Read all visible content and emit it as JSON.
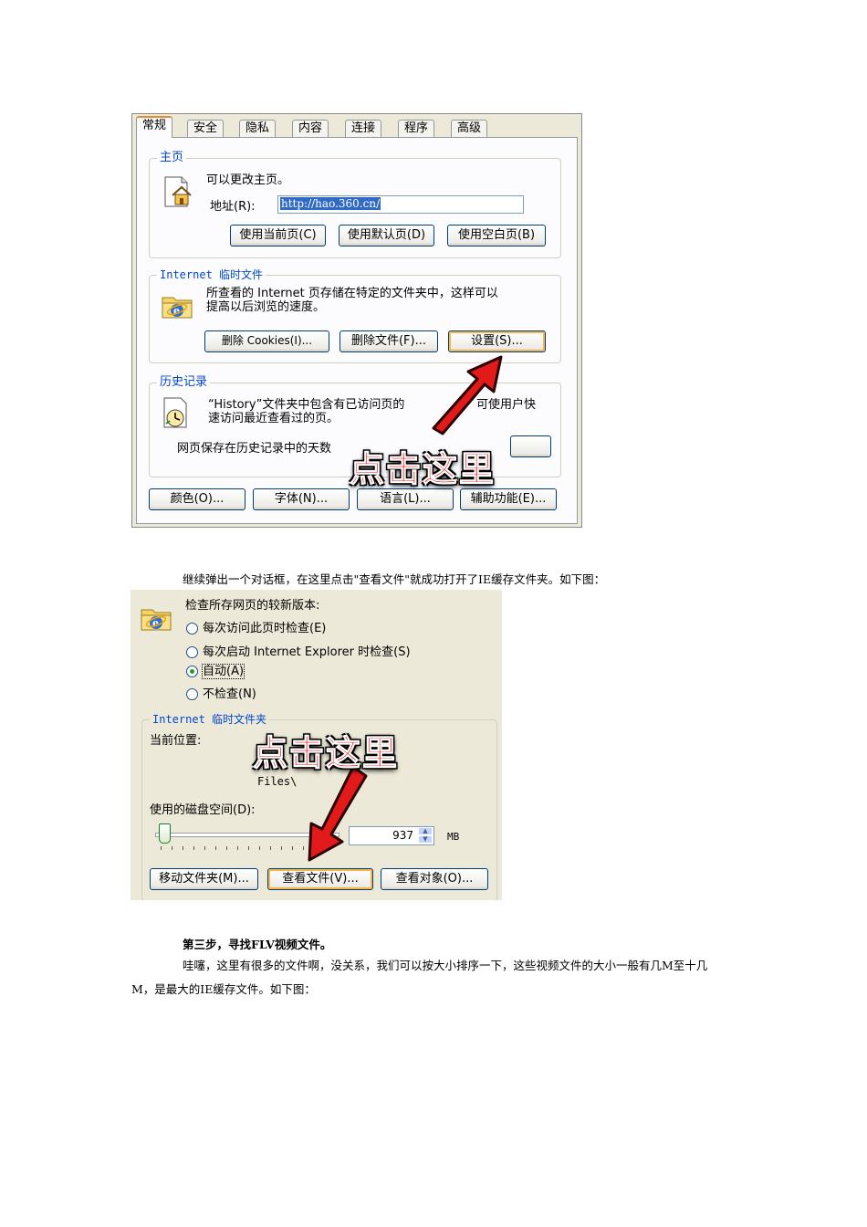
{
  "dialog1": {
    "tabs": [
      "常规",
      "安全",
      "隐私",
      "内容",
      "连接",
      "程序",
      "高级"
    ],
    "homepage": {
      "title": "主页",
      "desc": "可以更改主页。",
      "address_label": "地址(R):",
      "address_value": "http://hao.360.cn/",
      "buttons": [
        "使用当前页(C)",
        "使用默认页(D)",
        "使用空白页(B)"
      ]
    },
    "temp_files": {
      "title": "Internet 临时文件",
      "desc_line1": "所查看的 Internet 页存储在特定的文件夹中，这样可以",
      "desc_line2": "提高以后浏览的速度。",
      "buttons": [
        "删除 Cookies(I)...",
        "删除文件(F)...",
        "设置(S)..."
      ]
    },
    "history": {
      "title": "历史记录",
      "desc_line1": "“History”文件夹中包含有已访问页的",
      "desc_line1b": "可使用户快",
      "desc_line2": "速访问最近查看过的页。",
      "days_label": "网页保存在历史记录中的天数"
    },
    "bottom_buttons": [
      "颜色(O)...",
      "字体(N)...",
      "语言(L)...",
      "辅助功能(E)..."
    ],
    "callout": "点击这里"
  },
  "caption1": "继续弹出一个对话框，在这里点击\"查看文件\"就成功打开了IE缓存文件夹。如下图：",
  "dialog2": {
    "check_label": "检查所存网页的较新版本:",
    "options": [
      {
        "label": "每次访问此页时检查(E)",
        "selected": false
      },
      {
        "label": "每次启动 Internet Explorer 时检查(S)",
        "selected": false
      },
      {
        "label": "自动(A)",
        "selected": true
      },
      {
        "label": "不检查(N)",
        "selected": false
      }
    ],
    "group_title": "Internet 临时文件夹",
    "location_label": "当前位置:",
    "location_tail": "Files\\",
    "disk_label": "使用的磁盘空间(D):",
    "disk_value": "937",
    "disk_unit": "MB",
    "buttons": [
      "移动文件夹(M)...",
      "查看文件(V)...",
      "查看对象(O)..."
    ],
    "callout": "点击这里"
  },
  "step3_title": "第三步，寻找FLV视频文件。",
  "step3_line1": "哇噻，这里有很多的文件啊，没关系，我们可以按大小排序一下，这些视频文件的大小一般有几M至十几",
  "step3_line2": "M，是最大的IE缓存文件。如下图：",
  "colors": {
    "dialog_bg": "#ece9d8",
    "group_title": "#0046d5",
    "callout_red": "#e80000",
    "tab_highlight": "#e68b2c"
  },
  "icons": [
    "house-icon",
    "ie-folder-icon",
    "history-clock-icon",
    "red-arrow-icon"
  ]
}
